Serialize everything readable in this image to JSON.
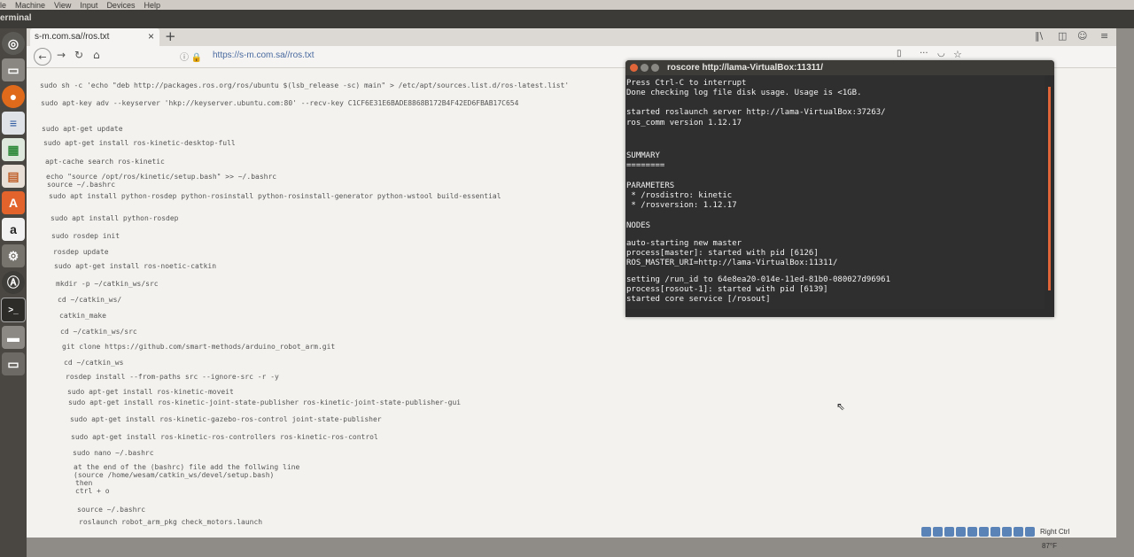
{
  "host_menu": [
    "le",
    "Machine",
    "View",
    "Input",
    "Devices",
    "Help"
  ],
  "guest_bar_title": "erminal",
  "browser": {
    "tab_title": "s-m.com.sa//ros.txt",
    "url": "https://s-m.com.sa//ros.txt"
  },
  "commands": [
    "sudo sh -c 'echo \"deb http://packages.ros.org/ros/ubuntu $(lsb_release -sc) main\" > /etc/apt/sources.list.d/ros-latest.list'",
    "sudo apt-key adv --keyserver 'hkp://keyserver.ubuntu.com:80' --recv-key C1CF6E31E6BADE8868B172B4F42ED6FBAB17C654",
    "sudo apt-get update",
    "sudo apt-get install ros-kinetic-desktop-full",
    "apt-cache search ros-kinetic",
    "echo \"source /opt/ros/kinetic/setup.bash\" >> ~/.bashrc",
    "source ~/.bashrc",
    "sudo apt install python-rosdep python-rosinstall python-rosinstall-generator python-wstool build-essential",
    "sudo apt install python-rosdep",
    "sudo rosdep init",
    "rosdep update",
    "sudo apt-get install ros-noetic-catkin",
    "mkdir -p ~/catkin_ws/src",
    "cd ~/catkin_ws/",
    "catkin_make",
    "cd ~/catkin_ws/src",
    "git clone https://github.com/smart-methods/arduino_robot_arm.git",
    "cd ~/catkin_ws",
    "rosdep install --from-paths src --ignore-src -r -y",
    "sudo apt-get install ros-kinetic-moveit",
    "sudo apt-get install ros-kinetic-joint-state-publisher ros-kinetic-joint-state-publisher-gui",
    "sudo apt-get install ros-kinetic-gazebo-ros-control joint-state-publisher",
    "sudo apt-get install ros-kinetic-ros-controllers ros-kinetic-ros-control",
    "sudo nano ~/.bashrc",
    "at the end of the (bashrc) file add the follwing line",
    "(source /home/wesam/catkin_ws/devel/setup.bash)",
    "then",
    "ctrl + o",
    "source ~/.bashrc",
    "roslaunch robot_arm_pkg check_motors.launch"
  ],
  "terminal": {
    "title": "roscore http://lama-VirtualBox:11311/",
    "lines": [
      "Press Ctrl-C to interrupt",
      "Done checking log file disk usage. Usage is <1GB.",
      "started roslaunch server http://lama-VirtualBox:37263/",
      "ros_comm version 1.12.17",
      "SUMMARY",
      "========",
      "PARAMETERS",
      " * /rosdistro: kinetic",
      " * /rosversion: 1.12.17",
      "NODES",
      "auto-starting new master",
      "process[master]: started with pid [6126]",
      "ROS_MASTER_URI=http://lama-VirtualBox:11311/",
      "setting /run_id to 64e8ea20-014e-11ed-81b0-080027d96961",
      "process[rosout-1]: started with pid [6139]",
      "started core service [/rosout]"
    ]
  },
  "status": {
    "host_key": "Right Ctrl",
    "temperature": "87°F"
  },
  "launcher_icons": [
    "dash-icon",
    "files-icon",
    "firefox-icon",
    "writer-icon",
    "calc-icon",
    "impress-icon",
    "software-center-icon",
    "amazon-icon",
    "settings-icon",
    "updater-icon",
    "terminal-icon",
    "drive-icon",
    "trash-icon"
  ],
  "colors": {
    "terminal_bg": "#2f2f2f",
    "close_button": "#e0663a",
    "launcher_bg": "#4a4742"
  }
}
